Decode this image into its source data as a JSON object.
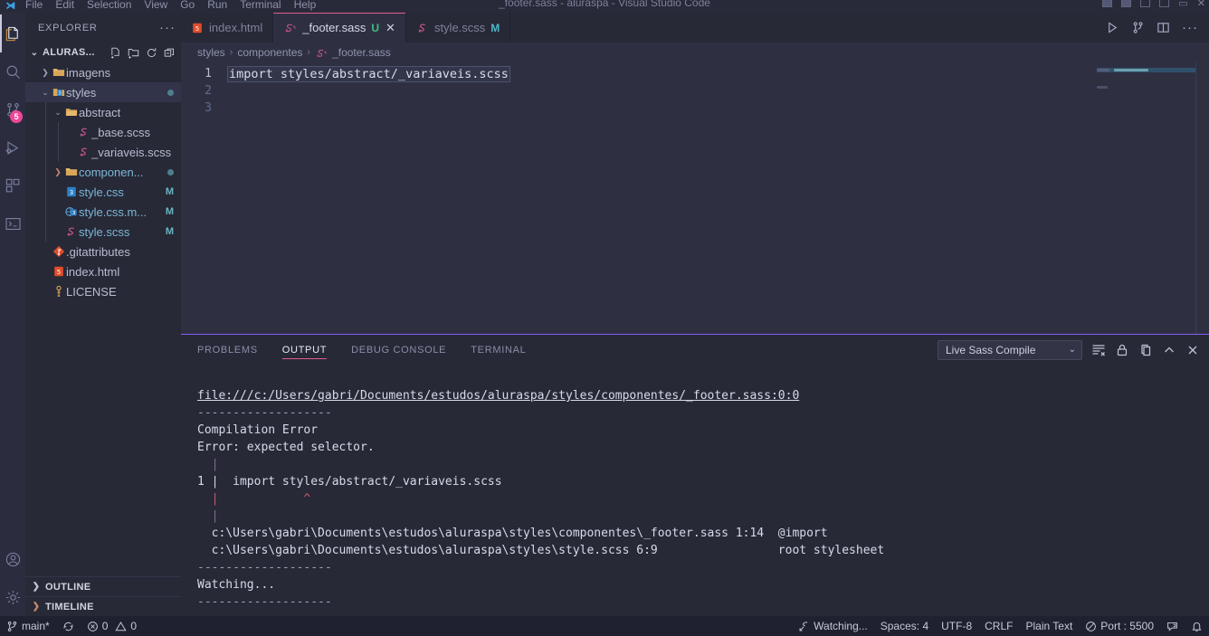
{
  "titlebar": {
    "menus": [
      "File",
      "Edit",
      "Selection",
      "View",
      "Go",
      "Run",
      "Terminal",
      "Help"
    ],
    "window_title": "_footer.sass - aluraspa - Visual Studio Code"
  },
  "activitybar": {
    "items": [
      {
        "name": "explorer",
        "icon": "files-icon",
        "active": true,
        "badge": ""
      },
      {
        "name": "search",
        "icon": "search-icon",
        "active": false,
        "badge": ""
      },
      {
        "name": "source-control",
        "icon": "source-control-icon",
        "active": false,
        "badge": "5"
      },
      {
        "name": "run-and-debug",
        "icon": "run-debug-icon",
        "active": false,
        "badge": ""
      },
      {
        "name": "extensions",
        "icon": "extensions-icon",
        "active": false,
        "badge": ""
      },
      {
        "name": "remote-explorer",
        "icon": "remote-terminal-icon",
        "active": false,
        "badge": ""
      }
    ],
    "bottom_items": [
      {
        "name": "accounts",
        "icon": "account-icon"
      },
      {
        "name": "manage",
        "icon": "gear-icon"
      }
    ]
  },
  "sidebar": {
    "title": "EXPLORER",
    "more_actions": "···",
    "project": {
      "label": "ALURAS...",
      "actions": [
        "new-file-icon",
        "new-folder-icon",
        "refresh-icon",
        "collapse-all-icon"
      ]
    },
    "tree": [
      {
        "label": "imagens",
        "icon": "folder-icon",
        "indent": 1,
        "twisty": ">",
        "selected": false,
        "dot": false,
        "git": ""
      },
      {
        "label": "styles",
        "icon": "folder-css-icon",
        "indent": 1,
        "twisty": "v",
        "selected": true,
        "dot": true,
        "git": ""
      },
      {
        "label": "abstract",
        "icon": "folder-open-icon",
        "indent": 2,
        "twisty": "v",
        "selected": false,
        "dot": false,
        "git": ""
      },
      {
        "label": "_base.scss",
        "icon": "sass-icon",
        "indent": 3,
        "twisty": "",
        "selected": false,
        "dot": false,
        "git": ""
      },
      {
        "label": "_variaveis.scss",
        "icon": "sass-icon",
        "indent": 3,
        "twisty": "",
        "selected": false,
        "dot": false,
        "git": ""
      },
      {
        "label": "componen...",
        "icon": "folder-icon",
        "indent": 2,
        "twisty": ">",
        "selected": false,
        "dot": true,
        "git": ""
      },
      {
        "label": "style.css",
        "icon": "css-icon",
        "indent": 2,
        "twisty": "",
        "selected": false,
        "dot": false,
        "git": "M"
      },
      {
        "label": "style.css.m...",
        "icon": "map-icon",
        "indent": 2,
        "twisty": "",
        "selected": false,
        "dot": false,
        "git": "M"
      },
      {
        "label": "style.scss",
        "icon": "sass-icon",
        "indent": 2,
        "twisty": "",
        "selected": false,
        "dot": false,
        "git": "M"
      },
      {
        "label": ".gitattributes",
        "icon": "git-icon",
        "indent": 1,
        "twisty": "",
        "selected": false,
        "dot": false,
        "git": ""
      },
      {
        "label": "index.html",
        "icon": "html-icon",
        "indent": 1,
        "twisty": "",
        "selected": false,
        "dot": false,
        "git": ""
      },
      {
        "label": "LICENSE",
        "icon": "license-icon",
        "indent": 1,
        "twisty": "",
        "selected": false,
        "dot": false,
        "git": ""
      }
    ],
    "outline": "OUTLINE",
    "timeline": "TIMELINE"
  },
  "editor": {
    "tabs": [
      {
        "label": "index.html",
        "icon": "html-icon",
        "state": "",
        "active": false,
        "closable": false
      },
      {
        "label": "_footer.sass",
        "icon": "sass-doc-icon",
        "state": "U",
        "active": true,
        "closable": true
      },
      {
        "label": "style.scss",
        "icon": "sass-icon",
        "state": "M",
        "active": false,
        "closable": false
      }
    ],
    "tab_actions": [
      "run-icon",
      "source-control-split-icon",
      "split-editor-icon",
      "more-actions-icon"
    ],
    "breadcrumb": [
      "styles",
      "componentes",
      "_footer.sass"
    ],
    "breadcrumb_separator": "›",
    "lines": [
      {
        "no": "1",
        "text": "import styles/abstract/_variaveis.scss",
        "highlight": true
      },
      {
        "no": "2",
        "text": "",
        "highlight": false
      },
      {
        "no": "3",
        "text": "",
        "highlight": false
      }
    ]
  },
  "panel": {
    "tabs": [
      {
        "label": "PROBLEMS",
        "active": false
      },
      {
        "label": "OUTPUT",
        "active": true
      },
      {
        "label": "DEBUG CONSOLE",
        "active": false
      },
      {
        "label": "TERMINAL",
        "active": false
      }
    ],
    "channel_selected": "Live Sass Compile",
    "actions": [
      "clear-output-icon",
      "lock-scroll-icon",
      "open-in-editor-icon",
      "maximize-panel-icon",
      "close-panel-icon"
    ],
    "output_lines": [
      {
        "text": "file:///c:/Users/gabri/Documents/estudos/aluraspa/styles/componentes/_footer.sass:0:0",
        "style": "link"
      },
      {
        "text": "-------------------",
        "style": "dim"
      },
      {
        "text": "Compilation Error",
        "style": "white"
      },
      {
        "text": "Error: expected selector.",
        "style": "white"
      },
      {
        "text": "  |",
        "style": "bar"
      },
      {
        "text": "1 |  import styles/abstract/_variaveis.scss",
        "style": "code"
      },
      {
        "text": "  |            ^",
        "style": "caret"
      },
      {
        "text": "  |",
        "style": "bar"
      },
      {
        "text": "  c:\\Users\\gabri\\Documents\\estudos\\aluraspa\\styles\\componentes\\_footer.sass 1:14  @import",
        "style": "white"
      },
      {
        "text": "  c:\\Users\\gabri\\Documents\\estudos\\aluraspa\\styles\\style.scss 6:9                 root stylesheet",
        "style": "white"
      },
      {
        "text": "-------------------",
        "style": "dim"
      },
      {
        "text": "Watching...",
        "style": "white"
      },
      {
        "text": "-------------------",
        "style": "dim"
      }
    ]
  },
  "statusbar": {
    "left": [
      {
        "label": "main*",
        "icon": "source-control-branch-icon"
      },
      {
        "label": "",
        "icon": "sync-icon"
      },
      {
        "label": "0",
        "icon": "error-icon",
        "label2": "0",
        "icon2": "warning-icon"
      }
    ],
    "branch": "main*",
    "errors": "0",
    "warnings": "0",
    "right": [
      {
        "label": "Watching...",
        "icon": "sass-watch-icon"
      },
      {
        "label": "Spaces: 4",
        "icon": ""
      },
      {
        "label": "UTF-8",
        "icon": ""
      },
      {
        "label": "CRLF",
        "icon": ""
      },
      {
        "label": "Plain Text",
        "icon": ""
      },
      {
        "label": "Port : 5500",
        "icon": "no-port-icon"
      },
      {
        "label": "",
        "icon": "feedback-icon"
      },
      {
        "label": "",
        "icon": "bell-icon"
      }
    ]
  },
  "colors": {
    "accent_pink": "#e05c8a",
    "panel_top_border": "#8a5cf6",
    "badge_pink": "#ec4899",
    "git_modified": "#4db8c9",
    "git_untracked": "#3fbf7f",
    "editor_bg": "#2e3042",
    "sidebar_bg": "#272937",
    "activitybar_bg": "#2b2d3f",
    "statusbar_bg": "#1f2130"
  }
}
